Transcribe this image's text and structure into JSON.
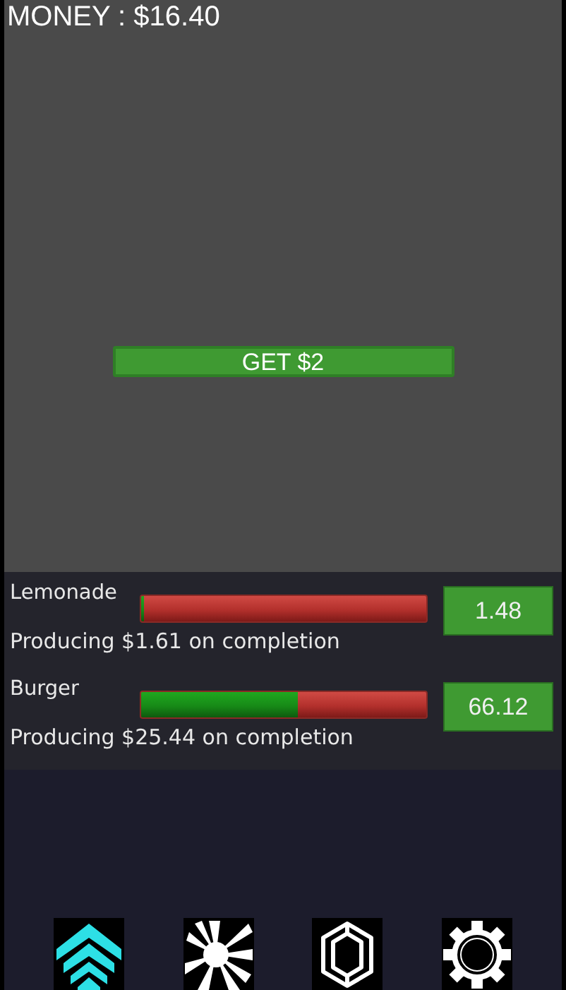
{
  "money": "MONEY : $16.40",
  "get_button": "GET $2",
  "businesses": [
    {
      "name": "Lemonade",
      "level": 0.01,
      "producing": "Producing $1.61 on completion",
      "value": "1.48"
    },
    {
      "name": "Burger",
      "level": 0.55,
      "producing": "Producing $25.44 on completion",
      "value": "66.12"
    }
  ],
  "tabs": [
    {
      "kind": "upgrade",
      "selected": true
    },
    {
      "kind": "burst",
      "selected": false
    },
    {
      "kind": "gem",
      "selected": false
    },
    {
      "kind": "settings",
      "selected": false
    }
  ]
}
